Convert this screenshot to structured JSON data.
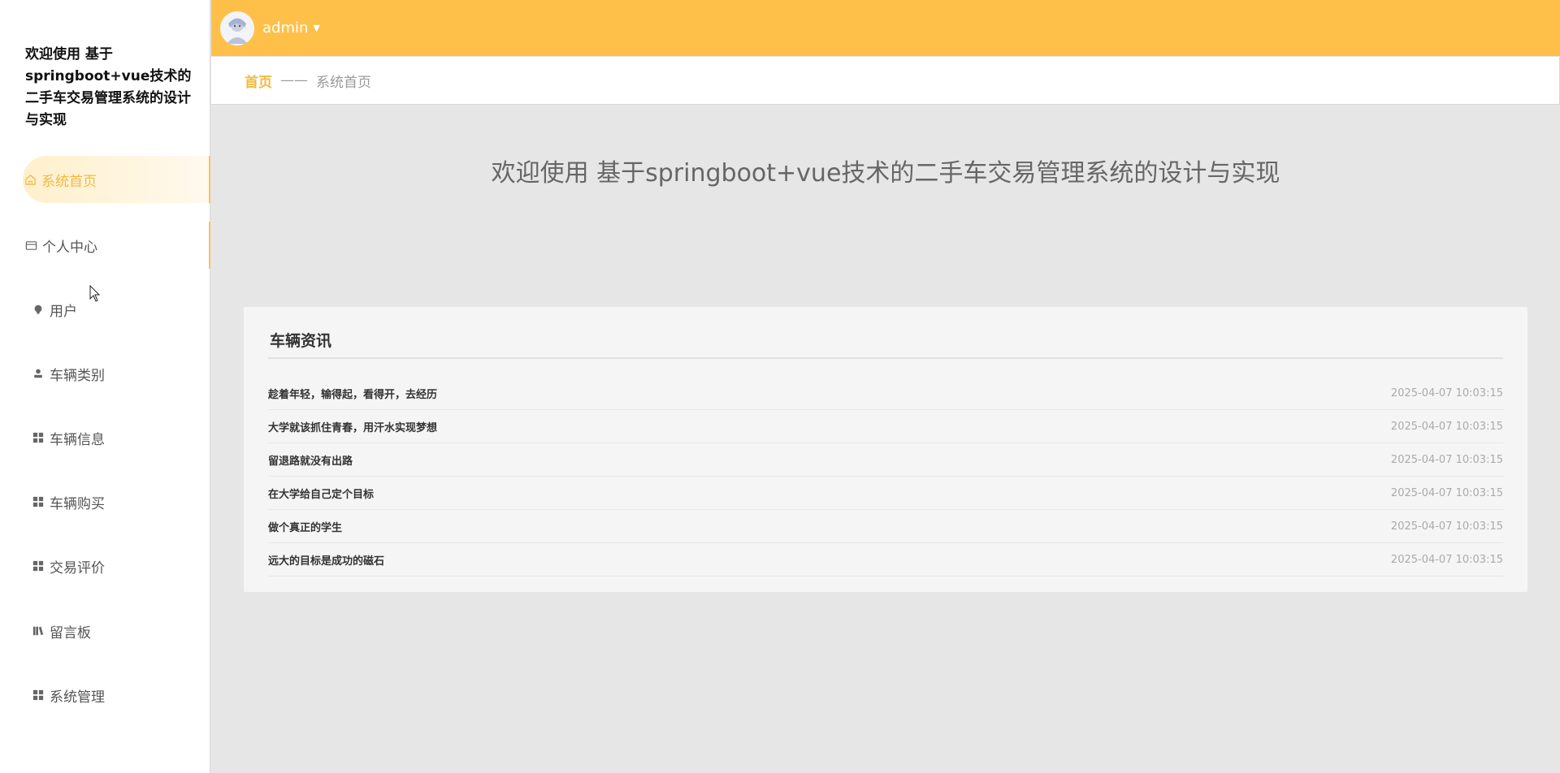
{
  "sidebar": {
    "title": "欢迎使用 基于springboot+vue技术的二手车交易管理系统的设计与实现",
    "items": [
      {
        "label": "系统首页",
        "icon": "home-icon"
      },
      {
        "label": "个人中心",
        "icon": "card-icon"
      },
      {
        "label": "用户",
        "icon": "pin-icon"
      },
      {
        "label": "车辆类别",
        "icon": "user-icon"
      },
      {
        "label": "车辆信息",
        "icon": "grid-icon"
      },
      {
        "label": "车辆购买",
        "icon": "grid-icon"
      },
      {
        "label": "交易评价",
        "icon": "grid-icon"
      },
      {
        "label": "留言板",
        "icon": "book-icon"
      },
      {
        "label": "系统管理",
        "icon": "grid-icon"
      }
    ]
  },
  "header": {
    "username": "admin",
    "accent_color": "#ffc04a"
  },
  "breadcrumb": {
    "home": "首页",
    "separator": "——",
    "current": "系统首页"
  },
  "main": {
    "welcome": "欢迎使用 基于springboot+vue技术的二手车交易管理系统的设计与实现",
    "news": {
      "title": "车辆资讯",
      "items": [
        {
          "title": "趁着年轻，输得起，看得开，去经历",
          "date": "2025-04-07 10:03:15"
        },
        {
          "title": "大学就该抓住青春，用汗水实现梦想",
          "date": "2025-04-07 10:03:15"
        },
        {
          "title": "留退路就没有出路",
          "date": "2025-04-07 10:03:15"
        },
        {
          "title": "在大学给自己定个目标",
          "date": "2025-04-07 10:03:15"
        },
        {
          "title": "做个真正的学生",
          "date": "2025-04-07 10:03:15"
        },
        {
          "title": "远大的目标是成功的磁石",
          "date": "2025-04-07 10:03:15"
        }
      ]
    }
  }
}
